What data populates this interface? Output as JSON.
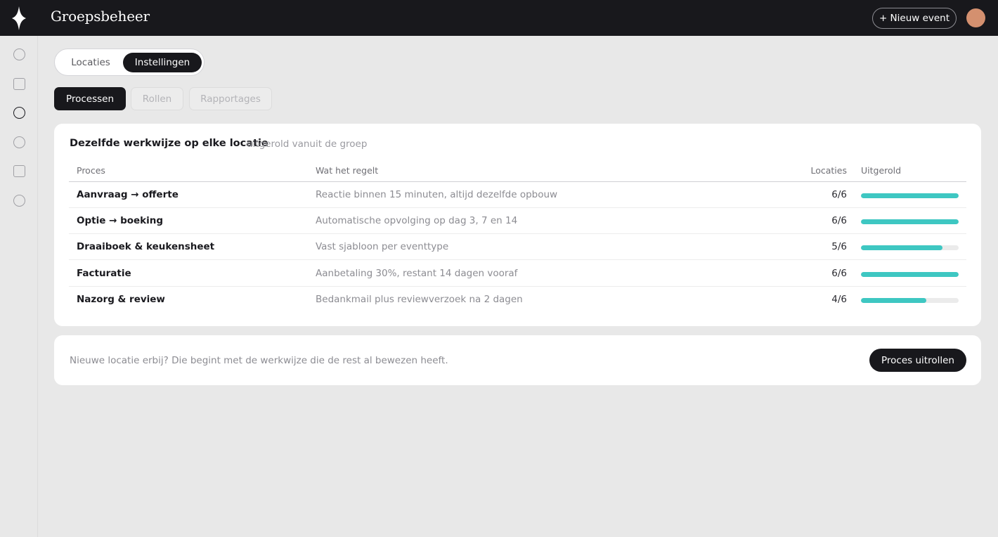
{
  "app": {
    "title": "Groepsbeheer"
  },
  "header": {
    "new_event_label": "+ Nieuw event",
    "avatar_color": "#d4906f"
  },
  "sidebar": {
    "icons": [
      {
        "name": "diamond-logo-icon"
      },
      {
        "name": "circle-nav-icon",
        "active": false
      },
      {
        "name": "square-nav-icon",
        "active": false
      },
      {
        "name": "circle-nav-icon",
        "active": true
      },
      {
        "name": "circle-nav-icon",
        "active": false
      },
      {
        "name": "square-nav-icon",
        "active": false
      },
      {
        "name": "circle-nav-icon",
        "active": false
      }
    ]
  },
  "tabs": {
    "items": [
      "Locaties",
      "Instellingen"
    ],
    "selected": "Instellingen"
  },
  "subtabs": {
    "items": [
      "Processen",
      "Rollen",
      "Rapportages"
    ],
    "selected": "Processen"
  },
  "card": {
    "title": "Dezelfde werkwijze op elke locatie",
    "subtitle": "uitgerold vanuit de groep",
    "columns": [
      "Proces",
      "Wat het regelt",
      "Locaties",
      "Uitgerold"
    ],
    "rows": [
      {
        "name": "Aanvraag → offerte",
        "desc": "Reactie binnen 15 minuten, altijd dezelfde opbouw",
        "count": "6/6",
        "progress": 1.0
      },
      {
        "name": "Optie → boeking",
        "desc": "Automatische opvolging op dag 3, 7 en 14",
        "count": "6/6",
        "progress": 1.0
      },
      {
        "name": "Draaiboek & keukensheet",
        "desc": "Vast sjabloon per eventtype",
        "count": "5/6",
        "progress": 0.833
      },
      {
        "name": "Facturatie",
        "desc": "Aanbetaling 30%, restant 14 dagen vooraf",
        "count": "6/6",
        "progress": 1.0
      },
      {
        "name": "Nazorg & review",
        "desc": "Bedankmail plus reviewverzoek na 2 dagen",
        "count": "4/6",
        "progress": 0.667
      }
    ]
  },
  "footer": {
    "text": "Nieuwe locatie erbij? Die begint met de werkwijze die de rest al bewezen heeft.",
    "button_label": "Proces uitrollen"
  },
  "colors": {
    "dark": "#18181c",
    "accent": "#3ec7c2",
    "background": "#e8e8e8"
  }
}
